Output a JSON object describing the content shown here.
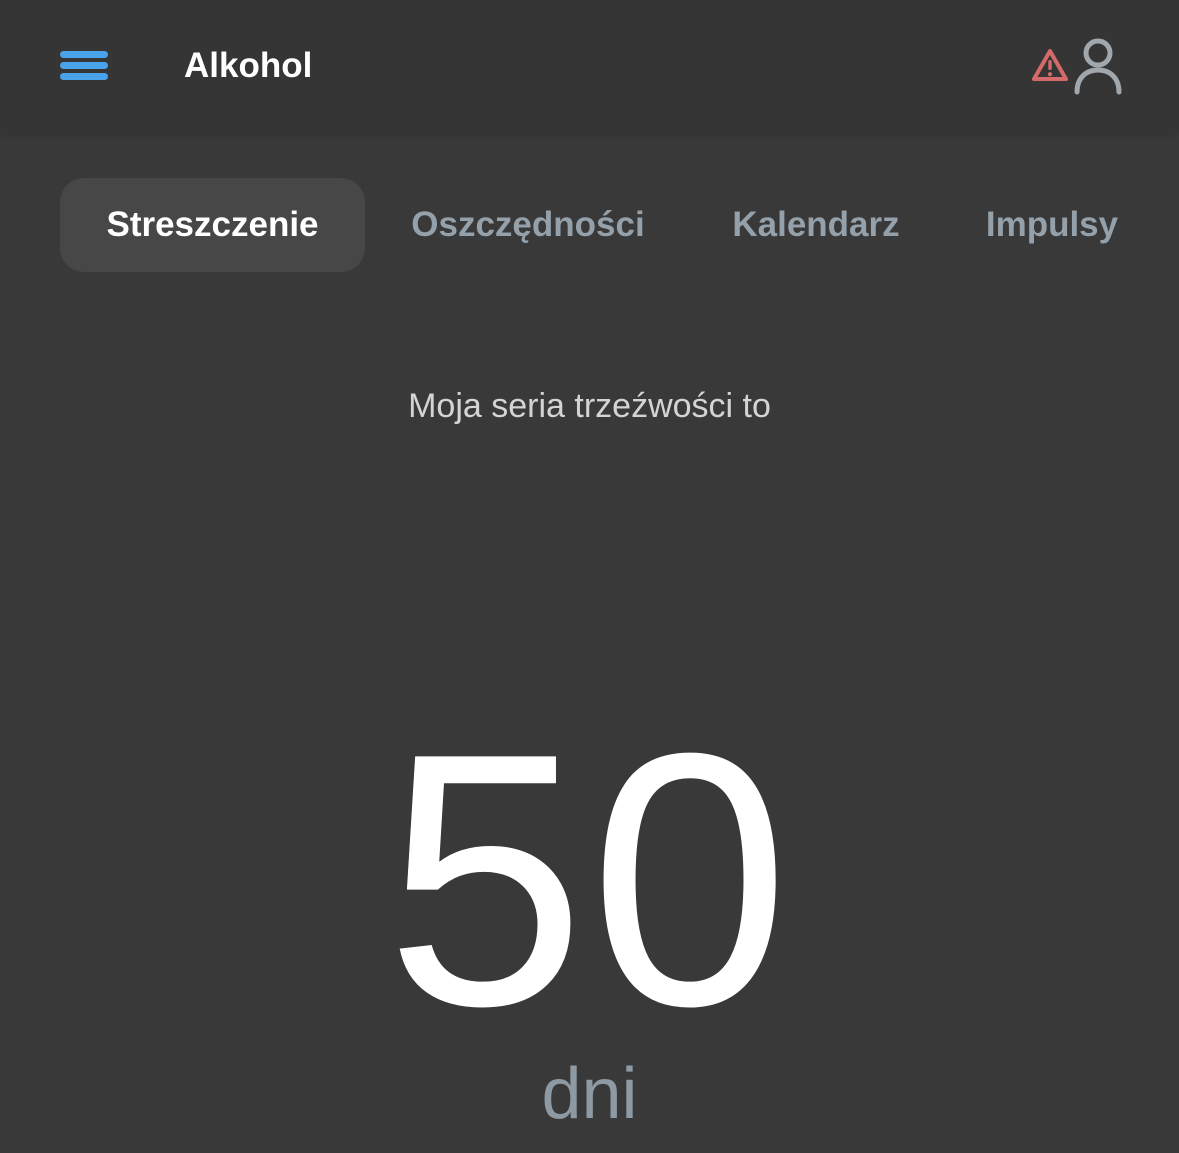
{
  "header": {
    "title": "Alkohol",
    "menu_icon": "hamburger-menu-icon",
    "warning_icon": "warning-triangle-icon",
    "profile_icon": "user-profile-icon",
    "accent_color": "#4aa3ea",
    "warning_color": "#d46a6a"
  },
  "tabs": [
    {
      "label": "Streszczenie",
      "active": true
    },
    {
      "label": "Oszczędności",
      "active": false
    },
    {
      "label": "Kalendarz",
      "active": false
    },
    {
      "label": "Impulsy",
      "active": false
    }
  ],
  "summary": {
    "subtitle": "Moja seria trzeźwości to",
    "streak_value": "50",
    "streak_unit": "dni"
  }
}
